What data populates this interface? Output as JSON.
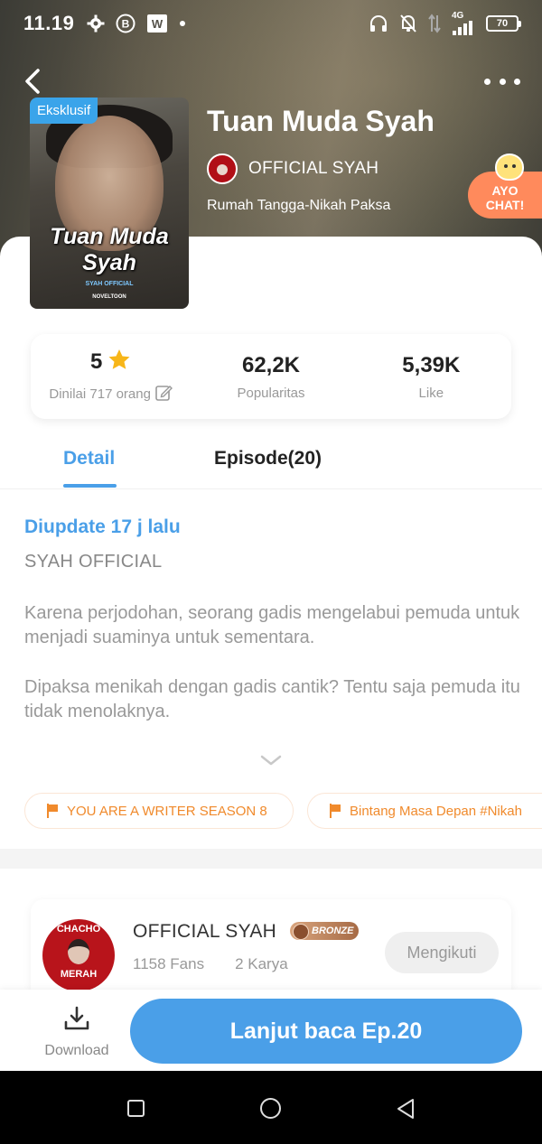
{
  "status_bar": {
    "time": "11.19",
    "network": "4G",
    "battery": "70",
    "icons_left": [
      "gear-icon",
      "b-icon",
      "w-icon",
      "dot-icon"
    ],
    "icons_right": [
      "headphones-icon",
      "bell-off-icon",
      "data-arrows-icon",
      "signal-icon",
      "battery-icon"
    ]
  },
  "book": {
    "exclusive_badge": "Eksklusif",
    "cover_title_line1": "Tuan Muda",
    "cover_title_line2": "Syah",
    "cover_sub": "SYAH OFFICIAL",
    "cover_brand": "NOVELTOON",
    "title": "Tuan Muda Syah",
    "author": "OFFICIAL SYAH",
    "genre": "Rumah Tangga-Nikah Paksa"
  },
  "ayo_chat": {
    "line1": "AYO",
    "line2": "CHAT!"
  },
  "stats": {
    "rating_value": "5",
    "rating_label": "Dinilai 717 orang",
    "popularity_value": "62,2K",
    "popularity_label": "Popularitas",
    "likes_value": "5,39K",
    "likes_label": "Like"
  },
  "tabs": {
    "detail": "Detail",
    "episode": "Episode(20)"
  },
  "detail": {
    "updated": "Diupdate 17 j lalu",
    "author_tag": "SYAH OFFICIAL",
    "desc1": "Karena perjodohan, seorang gadis mengelabui pemuda untuk menjadi suaminya untuk sementara.",
    "desc2": "Dipaksa menikah dengan gadis cantik? Tentu saja pemuda itu tidak menolaknya."
  },
  "chips": [
    "YOU ARE A WRITER SEASON 8",
    "Bintang Masa Depan #Nikah"
  ],
  "author_card": {
    "avatar_top": "CHACHO",
    "avatar_bottom": "MERAH",
    "name": "OFFICIAL SYAH",
    "badge": "BRONZE",
    "fans": "1158 Fans",
    "works": "2 Karya",
    "follow_label": "Mengikuti"
  },
  "bottom": {
    "download_label": "Download",
    "read_label": "Lanjut baca Ep.20"
  },
  "colors": {
    "accent": "#4a9fe8",
    "orange": "#f08a2c",
    "chat_bubble": "#ff8a5c"
  }
}
